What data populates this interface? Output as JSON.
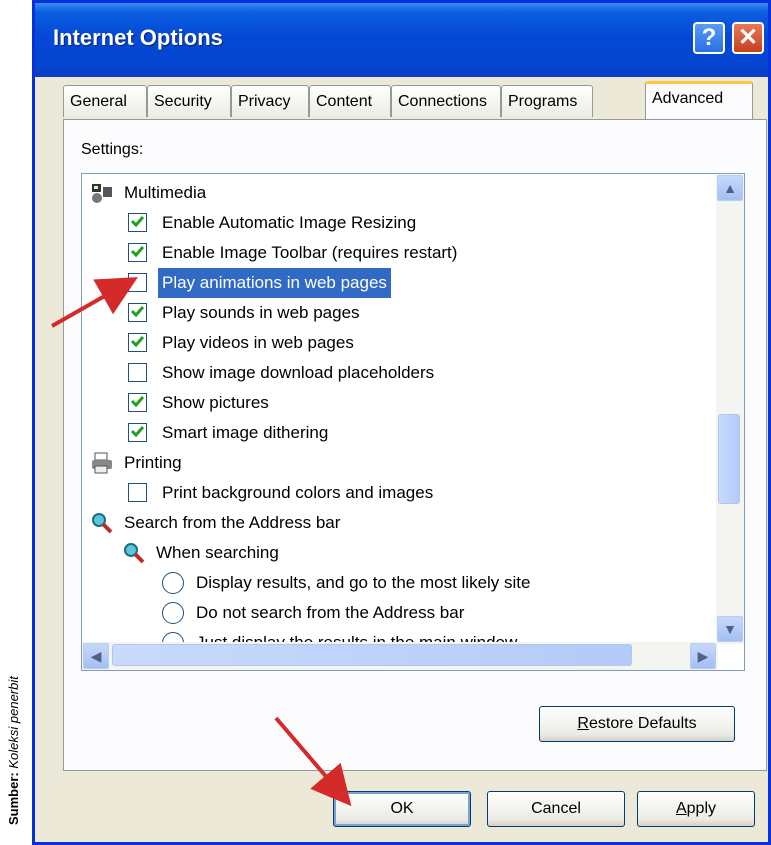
{
  "window": {
    "title": "Internet Options"
  },
  "tabs": [
    "General",
    "Security",
    "Privacy",
    "Content",
    "Connections",
    "Programs",
    "Advanced"
  ],
  "active_tab": "Advanced",
  "settings_label": "Settings:",
  "list": {
    "groups": {
      "multimedia": "Multimedia",
      "printing": "Printing",
      "search": "Search from the Address bar",
      "when_searching": "When searching"
    },
    "items": [
      {
        "label": "Enable Automatic Image Resizing",
        "checked": true
      },
      {
        "label": "Enable Image Toolbar (requires restart)",
        "checked": true
      },
      {
        "label": "Play animations in web pages",
        "checked": false,
        "selected": true
      },
      {
        "label": "Play sounds in web pages",
        "checked": true
      },
      {
        "label": "Play videos in web pages",
        "checked": true
      },
      {
        "label": "Show image download placeholders",
        "checked": false
      },
      {
        "label": "Show pictures",
        "checked": true
      },
      {
        "label": "Smart image dithering",
        "checked": true
      },
      {
        "label": "Print background colors and images",
        "checked": false
      }
    ],
    "radios": [
      "Display results, and go to the most likely site",
      "Do not search from the Address bar",
      "Just display the results in the main window"
    ]
  },
  "buttons": {
    "restore_rest": "estore Defaults",
    "restore_key": "R",
    "ok": "OK",
    "cancel": "Cancel",
    "apply_key": "A",
    "apply_rest": "pply"
  },
  "caption": {
    "bold": "Sumber:",
    "italic": "Koleksi penerbit"
  },
  "colors": {
    "titlebar": "#0548d6",
    "selection": "#316ac5",
    "annotation_arrow": "#d42a2a"
  }
}
